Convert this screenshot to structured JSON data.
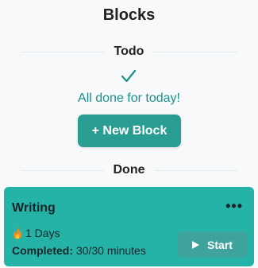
{
  "page": {
    "title": "Blocks"
  },
  "todo": {
    "header": "Todo",
    "empty_icon": "check-icon",
    "empty_message": "All done for today!",
    "new_block_label": "+ New Block"
  },
  "done": {
    "header": "Done",
    "blocks": [
      {
        "title": "Writing",
        "menu_label": "•••",
        "streak_icon": "flame-icon",
        "streak_text": "1 Days",
        "completed_label": "Completed:",
        "completed_value": "30/30 minutes",
        "start_icon": "play-icon",
        "start_label": "Start"
      }
    ]
  },
  "colors": {
    "accent": "#2a9d93",
    "card": "#26b3a7",
    "start_button": "#3fa39d",
    "message": "#1f8f8a"
  }
}
